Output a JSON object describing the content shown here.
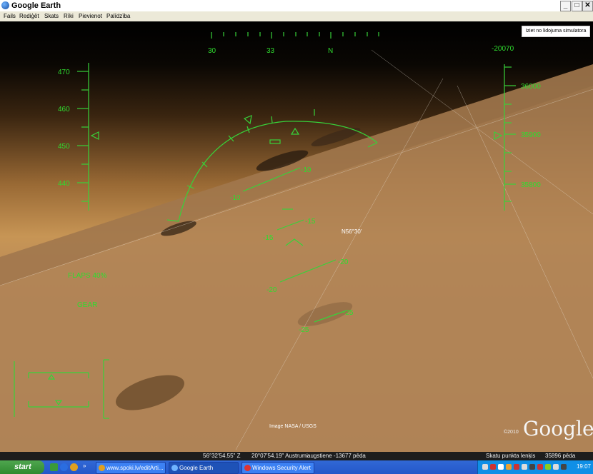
{
  "window": {
    "title": "Google Earth",
    "min": "_",
    "max": "□",
    "close": "✕"
  },
  "menu": [
    "Fails",
    "Rediģēt",
    "Skats",
    "Rīki",
    "Pievienot",
    "Palīdzība"
  ],
  "exit_button": "Iziet no lidojuma simulatora",
  "hud": {
    "heading": [
      "30",
      "33",
      "N"
    ],
    "speed": [
      "470",
      "460",
      "450",
      "440"
    ],
    "altitude": [
      "36000",
      "35900",
      "35800"
    ],
    "vertical_speed": "-20070",
    "pitch": [
      {
        "l": "-10",
        "r": "-10"
      },
      {
        "l": "-15",
        "r": "-15"
      },
      {
        "l": "-20",
        "r": "-20"
      },
      {
        "l": "-25",
        "r": "-25"
      }
    ],
    "flaps": "FLAPS 40%",
    "gear": "GEAR"
  },
  "map_label": "N56°30'",
  "image_credit": "Image NASA / USGS",
  "google": {
    "copyright": "©2010",
    "logo": "Google"
  },
  "status": {
    "lat": "56°32'54.55\" Z",
    "lon": "20°07'54.19\" Austrumi",
    "elev": "augstiene -13677 pēda",
    "eye_label": "Skatu punkta lenķis",
    "eye_alt": "35896 pēda"
  },
  "taskbar": {
    "start": "start",
    "tasks": [
      "www.spoki.lv/editArti...",
      "Google Earth",
      "Windows Security Alert"
    ],
    "clock": "19:07"
  },
  "colors": {
    "hud": "#38d23a",
    "taskbar": "#2457c9",
    "start": "#3a963a"
  }
}
